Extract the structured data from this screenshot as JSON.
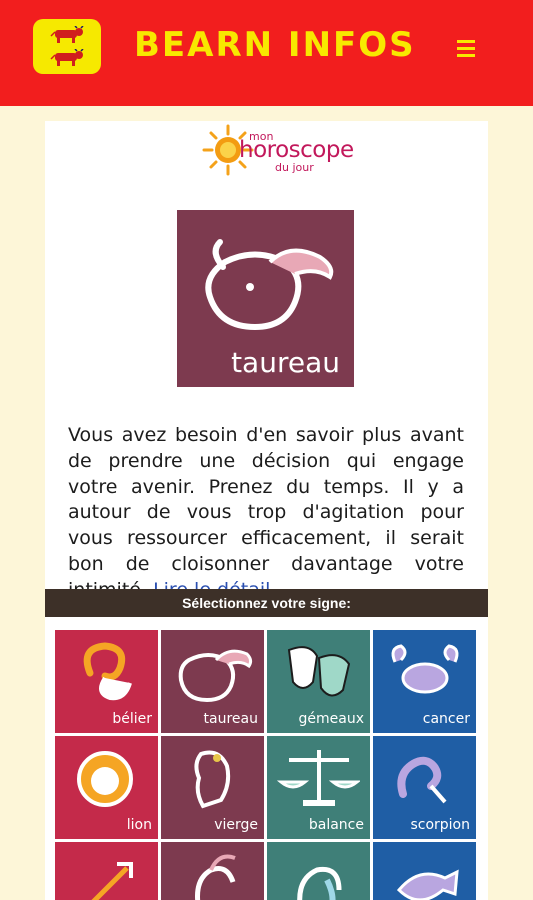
{
  "header": {
    "title": "BEARN INFOS",
    "menu_icon": "hamburger-menu-icon",
    "logo": "bearn-flag-logo",
    "colors": {
      "bar": "#f21e1e",
      "accent": "#f8e800"
    }
  },
  "brand": {
    "small_top": "mon",
    "main": "horoscope",
    "small_bottom": "du jour"
  },
  "current_sign": {
    "label": "taureau",
    "color": "#7d3a4f"
  },
  "horoscope": {
    "text": "Vous avez besoin d'en savoir plus avant de prendre une décision qui engage votre avenir. Prenez du temps. Il y a autour de vous trop d'agitation pour vous ressourcer efficacement, il serait bon de cloisonner davantage votre intimité.",
    "link": "Lire le détail"
  },
  "select_label": "Sélectionnez votre signe:",
  "signs": [
    {
      "label": "bélier",
      "color": "#c42a4a",
      "icon": "ram-icon"
    },
    {
      "label": "taureau",
      "color": "#7d3a4f",
      "icon": "bull-icon"
    },
    {
      "label": "gémeaux",
      "color": "#3f7f78",
      "icon": "theater-masks-icon"
    },
    {
      "label": "cancer",
      "color": "#1f5ea5",
      "icon": "crab-icon"
    },
    {
      "label": "lion",
      "color": "#c42a4a",
      "icon": "lion-icon"
    },
    {
      "label": "vierge",
      "color": "#7d3a4f",
      "icon": "virgin-icon"
    },
    {
      "label": "balance",
      "color": "#3f7f78",
      "icon": "scales-icon"
    },
    {
      "label": "scorpion",
      "color": "#1f5ea5",
      "icon": "scorpion-icon"
    },
    {
      "label": "",
      "color": "#c42a4a",
      "icon": "archer-icon"
    },
    {
      "label": "",
      "color": "#7d3a4f",
      "icon": "goat-icon"
    },
    {
      "label": "",
      "color": "#3f7f78",
      "icon": "water-bearer-icon"
    },
    {
      "label": "",
      "color": "#1f5ea5",
      "icon": "fish-icon"
    }
  ]
}
